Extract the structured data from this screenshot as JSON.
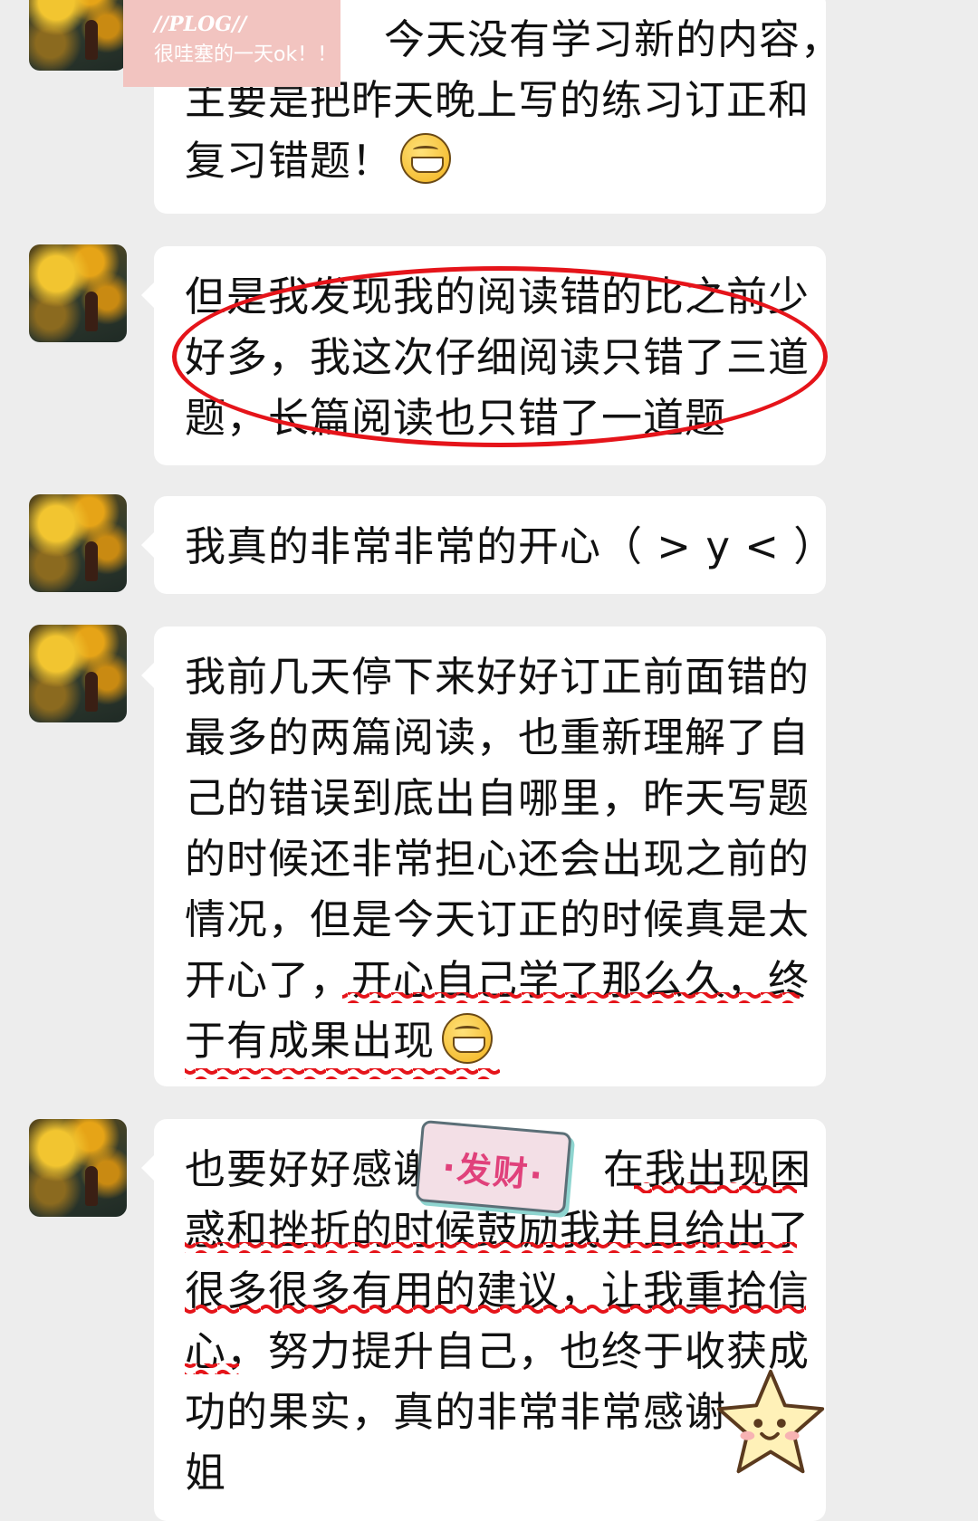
{
  "messages": [
    {
      "lines": [
        "今天没有学习新的内容，",
        "主要是把昨天晚上写的练习订正和",
        "复习错题！"
      ],
      "emoji": "grin-emoji"
    },
    {
      "lines": [
        "但是我发现我的阅读错的比之前少",
        "好多，我这次仔细阅读只错了三道",
        "题，长篇阅读也只错了一道题"
      ]
    },
    {
      "lines": [
        "我真的非常非常的开心（ > y < ）"
      ]
    },
    {
      "lines": [
        "我前几天停下来好好订正前面错的",
        "最多的两篇阅读，也重新理解了自",
        "己的错误到底出自哪里，昨天写题",
        "的时候还非常担心还会出现之前的",
        "情况，但是今天订正的时候真是太",
        "开心了，开心自己学了那么久，终",
        "于有成果出现"
      ],
      "emoji": "grin-emoji"
    },
    {
      "lines": [
        "也要好好感谢",
        "在我出现困",
        "惑和挫折的时候鼓励我并且给出了",
        "很多很多有用的建议，让我重拾信",
        "心，努力提升自己，也终于收获成",
        "功的果实，真的非常非常感谢",
        "姐"
      ]
    }
  ],
  "stickers": {
    "plog_line1": "//PLOG//",
    "plog_line2": "很哇塞的一天ok！！",
    "fortune": "·发财·"
  },
  "colors": {
    "background": "#ededed",
    "bubble": "#ffffff",
    "annotation_red": "#e5141a"
  }
}
